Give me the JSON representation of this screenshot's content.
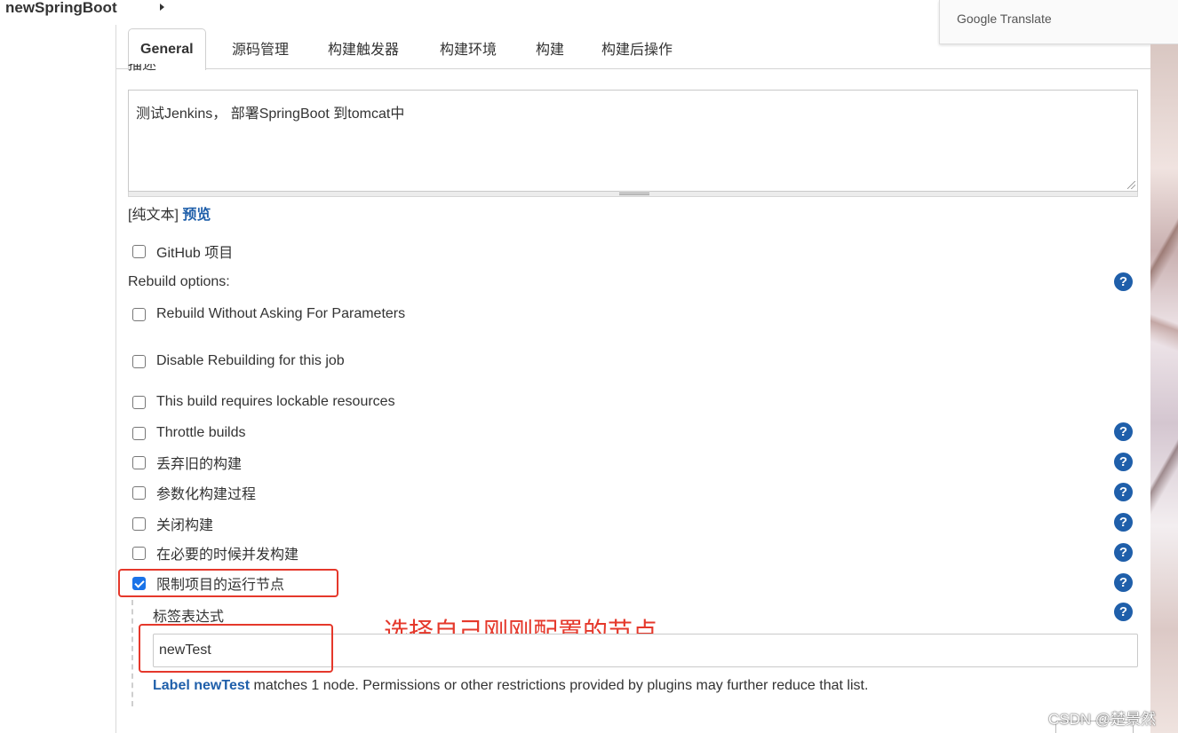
{
  "breadcrumb": {
    "job_name": "newSpringBoot"
  },
  "google_translate": {
    "label": "Google Translate"
  },
  "tabs": [
    {
      "label": "General",
      "active": true
    },
    {
      "label": "源码管理"
    },
    {
      "label": "构建触发器"
    },
    {
      "label": "构建环境"
    },
    {
      "label": "构建"
    },
    {
      "label": "构建后操作"
    }
  ],
  "description": {
    "label": "描述",
    "value": "测试Jenkins， 部署SpringBoot 到tomcat中",
    "format_prefix": "[纯文本]",
    "preview_link": "预览"
  },
  "options": {
    "github_project": "GitHub 项目",
    "rebuild_options_label": "Rebuild options:",
    "rebuild_without_params": "Rebuild Without Asking For Parameters",
    "disable_rebuilding": "Disable Rebuilding for this job",
    "lockable_resources": "This build requires lockable resources",
    "throttle_builds": "Throttle builds",
    "discard_old_builds": "丢弃旧的构建",
    "parameterized": "参数化构建过程",
    "disable_build": "关闭构建",
    "concurrent_builds": "在必要的时候并发构建",
    "restrict_node": "限制项目的运行节点"
  },
  "restrict_node": {
    "checked": true,
    "label_expression_title": "标签表达式",
    "label_expression_value": "newTest",
    "match_label": "Label newTest",
    "match_text": " matches 1 node. Permissions or other restrictions provided by plugins may further reduce that list."
  },
  "annotation": "选择自己刚刚配置的节点",
  "help_icon": "?",
  "watermark": "CSDN @楚景然",
  "colors": {
    "link": "#1f5faa",
    "highlight": "#e5382b",
    "help": "#1f5faa",
    "checkbox_checked": "#1a73e8"
  }
}
